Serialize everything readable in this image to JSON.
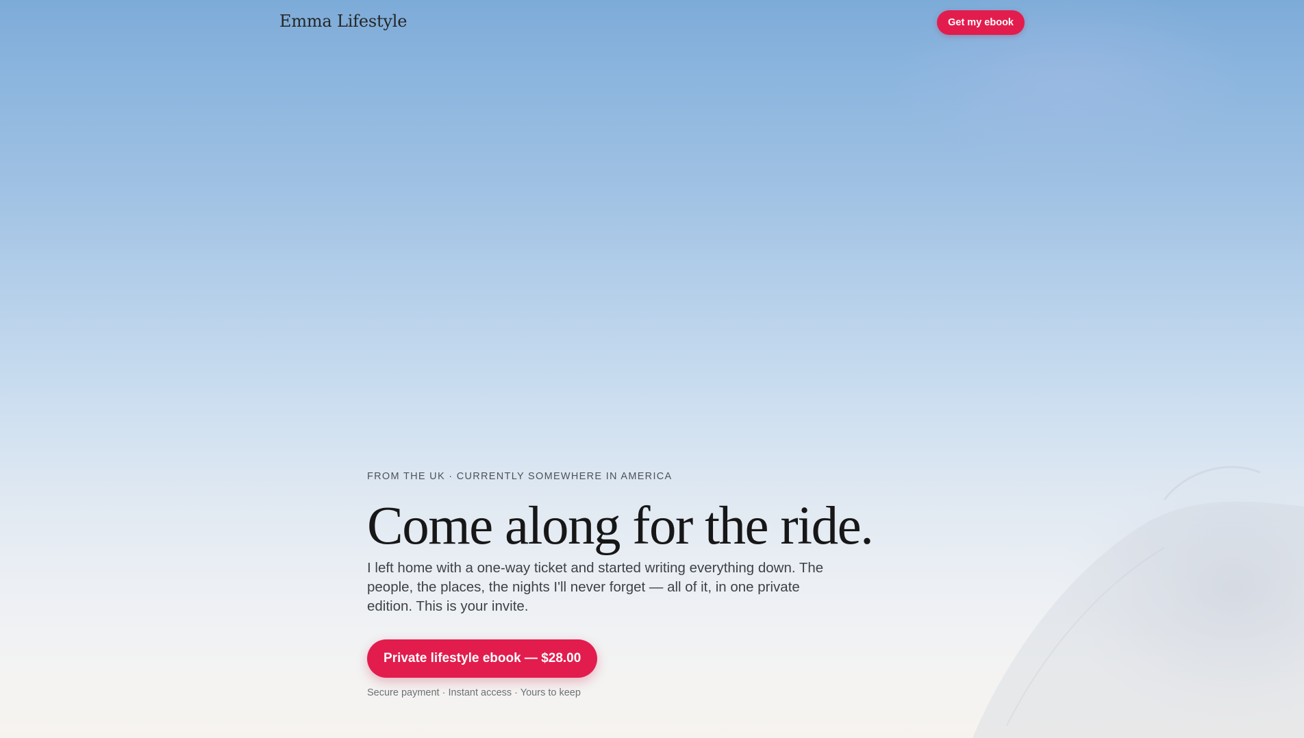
{
  "header": {
    "brand": "Emma Lifestyle",
    "cta_label": "Get my ebook"
  },
  "hero": {
    "eyebrow": "FROM THE UK · CURRENTLY SOMEWHERE IN AMERICA",
    "headline": "Come along for the ride.",
    "lead": "I left home with a one-way ticket and started writing everything down. The people, the places, the nights I'll never forget — all of it, in one private edition. This is your invite.",
    "buy_label": "Private lifestyle ebook — $28.00",
    "fineprint": "Secure payment · Instant access · Yours to keep"
  },
  "colors": {
    "accent": "#e21d4d",
    "sky_top": "#7dabd8",
    "sky_bottom": "#f6f3ef",
    "heading_text": "#171717",
    "body_text": "#3d4247"
  }
}
